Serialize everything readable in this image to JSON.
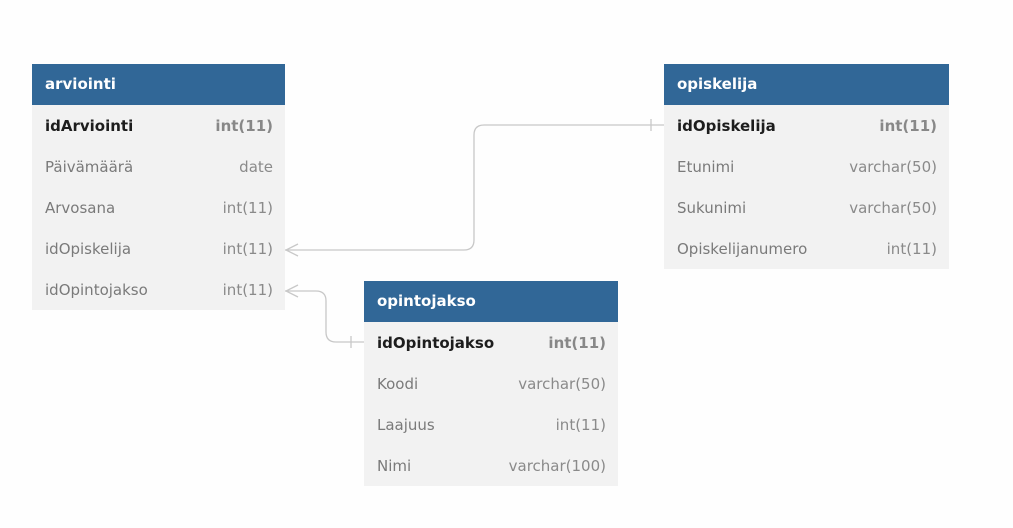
{
  "tables": {
    "arviointi": {
      "name": "arviointi",
      "fields": [
        {
          "name": "idArviointi",
          "type": "int(11)",
          "pk": true
        },
        {
          "name": "Päivämäärä",
          "type": "date",
          "pk": false
        },
        {
          "name": "Arvosana",
          "type": "int(11)",
          "pk": false
        },
        {
          "name": "idOpiskelija",
          "type": "int(11)",
          "pk": false
        },
        {
          "name": "idOpintojakso",
          "type": "int(11)",
          "pk": false
        }
      ]
    },
    "opiskelija": {
      "name": "opiskelija",
      "fields": [
        {
          "name": "idOpiskelija",
          "type": "int(11)",
          "pk": true
        },
        {
          "name": "Etunimi",
          "type": "varchar(50)",
          "pk": false
        },
        {
          "name": "Sukunimi",
          "type": "varchar(50)",
          "pk": false
        },
        {
          "name": "Opiskelijanumero",
          "type": "int(11)",
          "pk": false
        }
      ]
    },
    "opintojakso": {
      "name": "opintojakso",
      "fields": [
        {
          "name": "idOpintojakso",
          "type": "int(11)",
          "pk": true
        },
        {
          "name": "Koodi",
          "type": "varchar(50)",
          "pk": false
        },
        {
          "name": "Laajuus",
          "type": "int(11)",
          "pk": false
        },
        {
          "name": "Nimi",
          "type": "varchar(100)",
          "pk": false
        }
      ]
    }
  },
  "relations": [
    {
      "from_table": "arviointi",
      "from_field": "idOpiskelija",
      "from_cardinality": "many",
      "to_table": "opiskelija",
      "to_field": "idOpiskelija",
      "to_cardinality": "one"
    },
    {
      "from_table": "arviointi",
      "from_field": "idOpintojakso",
      "from_cardinality": "many",
      "to_table": "opintojakso",
      "to_field": "idOpintojakso",
      "to_cardinality": "one"
    }
  ],
  "colors": {
    "header_bg": "#316797",
    "header_text": "#ffffff",
    "body_bg": "#f2f2f2",
    "connector": "#c8c8c8"
  }
}
